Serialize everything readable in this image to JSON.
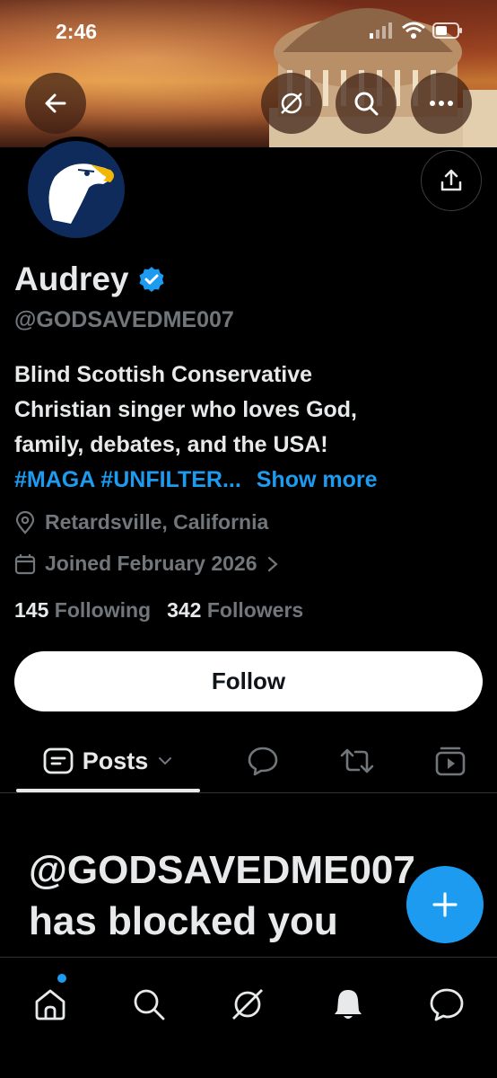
{
  "status_bar": {
    "time": "2:46"
  },
  "profile": {
    "name": "Audrey",
    "handle": "@GODSAVEDME007",
    "bio_line1": "Blind Scottish Conservative",
    "bio_line2": "Christian singer who loves God,",
    "bio_line3": "family, debates, and the USA!",
    "bio_hashtags": "#MAGA #UNFILTER...",
    "bio_show_more": "Show more",
    "location": "Retardsville, California",
    "joined": "Joined February 2026",
    "following_count": "145",
    "following_label": "Following",
    "followers_count": "342",
    "followers_label": "Followers",
    "follow_label": "Follow"
  },
  "tabs": {
    "posts_label": "Posts"
  },
  "blocked_message": {
    "line1": "@GODSAVEDME007",
    "line2": "has blocked you"
  },
  "colors": {
    "accent": "#1d9bf0",
    "background": "#000000",
    "text": "#e7e9ea",
    "muted": "#71767b"
  },
  "icons": [
    "back-arrow-icon",
    "grok-icon",
    "search-icon",
    "more-icon",
    "share-icon",
    "verified-badge-icon",
    "location-pin-icon",
    "calendar-icon",
    "chevron-right-icon",
    "posts-icon",
    "chevron-down-icon",
    "replies-icon",
    "repost-icon",
    "media-icon",
    "plus-icon",
    "home-icon",
    "notifications-icon",
    "messages-icon"
  ]
}
